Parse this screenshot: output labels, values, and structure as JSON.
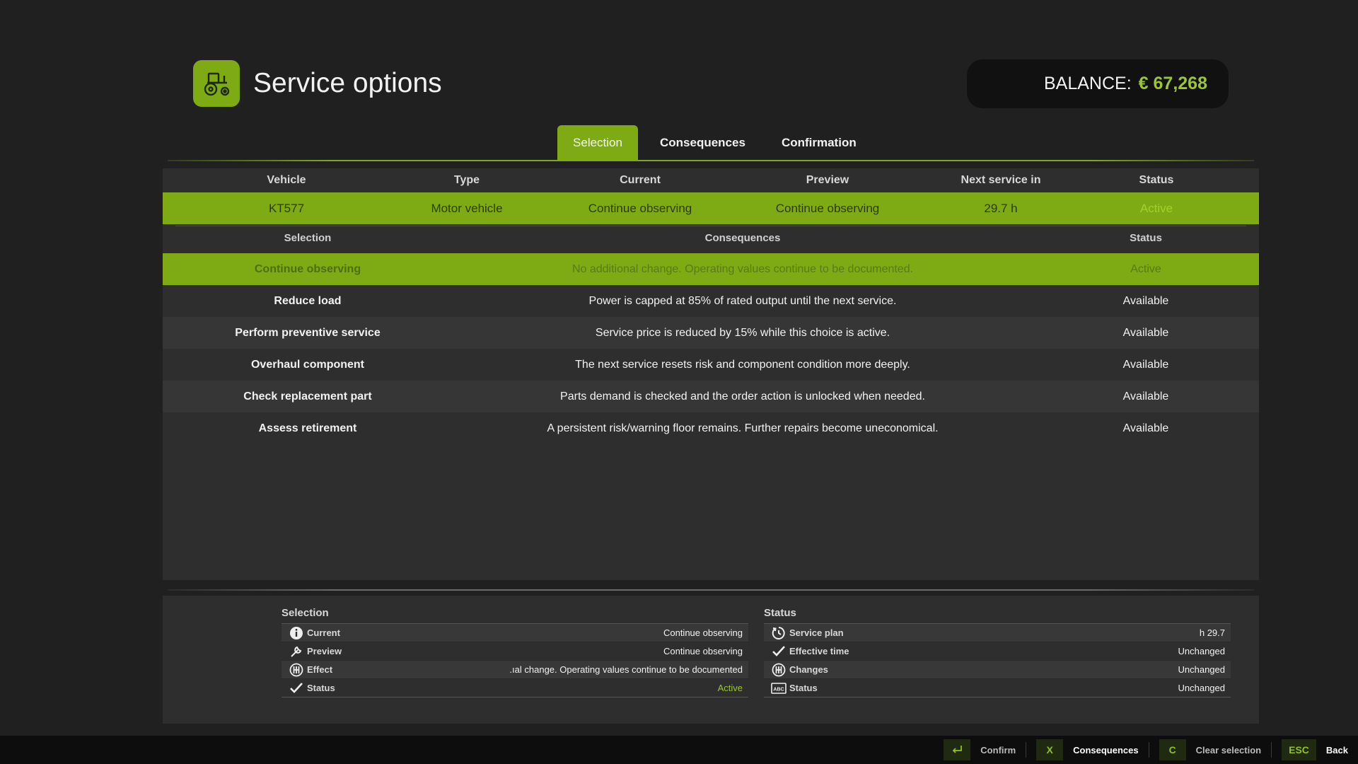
{
  "header": {
    "title": "Service options",
    "balance_label": "BALANCE:",
    "balance_value": "€ 67,268",
    "app_icon": "tractor-icon"
  },
  "tabs": [
    {
      "label": "Selection",
      "active": true
    },
    {
      "label": "Consequences",
      "active": false
    },
    {
      "label": "Confirmation",
      "active": false
    }
  ],
  "vehicle_table": {
    "columns": [
      "Vehicle",
      "Type",
      "Current",
      "Preview",
      "Next service in",
      "Status"
    ],
    "row": {
      "vehicle": "KT577",
      "type": "Motor vehicle",
      "current": "Continue observing",
      "preview": "Continue observing",
      "next_service": "29.7 h",
      "status": "Active"
    }
  },
  "options_table": {
    "columns": [
      "Selection",
      "Consequences",
      "Status"
    ],
    "rows": [
      {
        "selection": "Continue observing",
        "consequence": "No additional change. Operating values continue to be documented.",
        "status": "Active"
      },
      {
        "selection": "Reduce load",
        "consequence": "Power is capped at 85% of rated output until the next service.",
        "status": "Available"
      },
      {
        "selection": "Perform preventive service",
        "consequence": "Service price is reduced by 15% while this choice is active.",
        "status": "Available"
      },
      {
        "selection": "Overhaul component",
        "consequence": "The next service resets risk and component condition more deeply.",
        "status": "Available"
      },
      {
        "selection": "Check replacement part",
        "consequence": "Parts demand is checked and the order action is unlocked when needed.",
        "status": "Available"
      },
      {
        "selection": "Assess retirement",
        "consequence": "A persistent risk/warning floor remains. Further repairs become uneconomical.",
        "status": "Available"
      }
    ]
  },
  "details": {
    "selection": {
      "title": "Selection",
      "rows": [
        {
          "icon": "info-icon",
          "label": "Current",
          "value": "Continue observing"
        },
        {
          "icon": "wrench-icon",
          "label": "Preview",
          "value": "Continue observing"
        },
        {
          "icon": "gearbox-icon",
          "label": "Effect",
          "value": "ıal change. Operating values continue to be documented."
        },
        {
          "icon": "checkmark-icon",
          "label": "Status",
          "value": "Active"
        }
      ]
    },
    "status": {
      "title": "Status",
      "rows": [
        {
          "icon": "clock-icon",
          "label": "Service plan",
          "value": "29.7 h"
        },
        {
          "icon": "checkmark-icon",
          "label": "Effective time",
          "value": "Unchanged"
        },
        {
          "icon": "gearbox-icon",
          "label": "Changes",
          "value": "Unchanged"
        },
        {
          "icon": "abc-icon",
          "label": "Status",
          "value": "Unchanged"
        }
      ]
    }
  },
  "footer": {
    "confirm": {
      "key_icon": "enter-key-icon",
      "label": "Confirm"
    },
    "consequences": {
      "key": "X",
      "label": "Consequences"
    },
    "clear": {
      "key": "C",
      "label": "Clear selection"
    },
    "back": {
      "key": "ESC",
      "label": "Back"
    }
  },
  "colors": {
    "accent": "#7eab14",
    "balance_value": "#9cc535",
    "background": "#202020",
    "panel": "#2e2e2e"
  }
}
